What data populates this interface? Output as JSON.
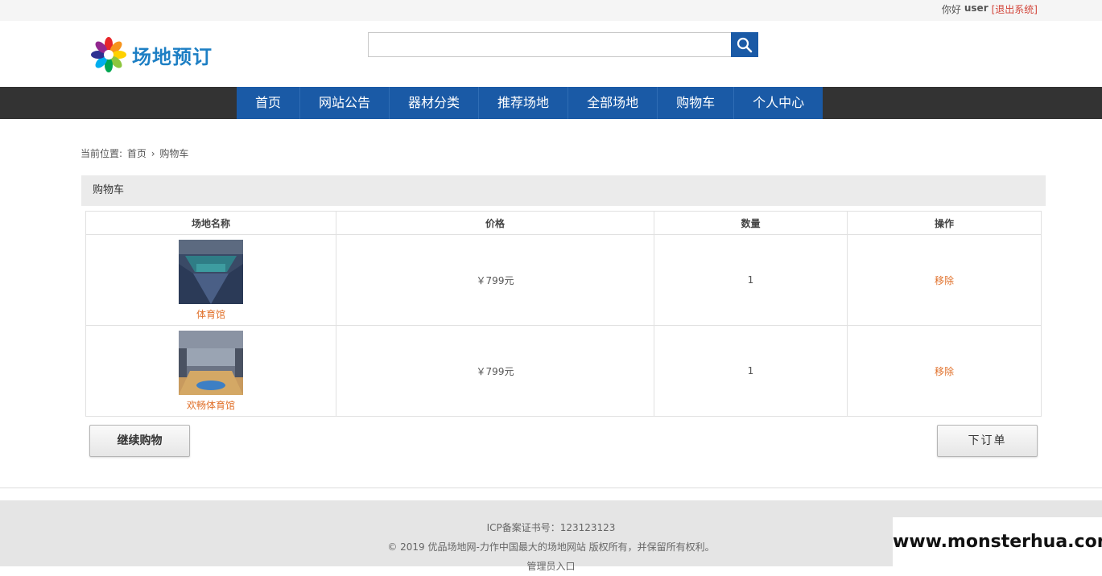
{
  "topbar": {
    "greeting": "你好",
    "username": "user",
    "logout": "[退出系统]"
  },
  "header": {
    "logo_text": "场地预订",
    "search": {
      "value": "",
      "placeholder": ""
    }
  },
  "nav": {
    "items": [
      "首页",
      "网站公告",
      "器材分类",
      "推荐场地",
      "全部场地",
      "购物车",
      "个人中心"
    ]
  },
  "breadcrumb": {
    "prefix": "当前位置:",
    "home": "首页",
    "separator": "›",
    "current": "购物车"
  },
  "panel": {
    "title": "购物车"
  },
  "table": {
    "headers": [
      "场地名称",
      "价格",
      "数量",
      "操作"
    ],
    "rows": [
      {
        "name": "体育馆",
        "price": "￥799元",
        "quantity": "1",
        "action": "移除",
        "image": "sports-hall-photo"
      },
      {
        "name": "欢畅体育馆",
        "price": "￥799元",
        "quantity": "1",
        "action": "移除",
        "image": "sports-hall-photo"
      }
    ]
  },
  "buttons": {
    "continue": "继续购物",
    "order": "下订单"
  },
  "footer": {
    "icp": "ICP备案证书号：123123123",
    "copyright": "© 2019 优品场地网-力作中国最大的场地网站 版权所有，并保留所有权利。",
    "admin": "管理员入口"
  },
  "watermark": "www.monsterhua.com",
  "colors": {
    "nav_blue": "#1a5aa6",
    "dark_bar": "#333333",
    "link_orange": "#e0702a",
    "logout_red": "#d2453a"
  },
  "icons": {
    "search": "search-icon",
    "logo": "flower-logo-icon",
    "breadcrumb_sep": "chevron-right-icon"
  }
}
